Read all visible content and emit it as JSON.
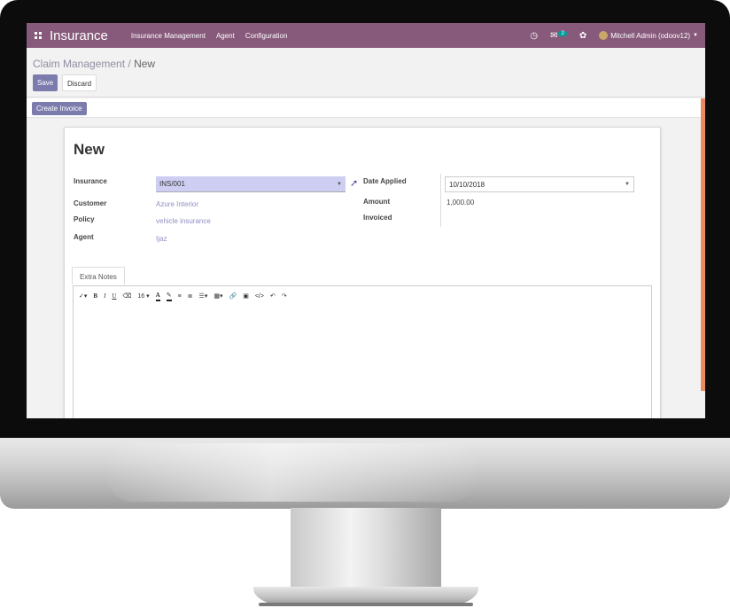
{
  "navbar": {
    "app_name": "Insurance",
    "menu": [
      "Insurance Management",
      "Agent",
      "Configuration"
    ],
    "chat_badge": "2",
    "user_name": "Mitchell Admin (odoov12)",
    "color": "#875a7b"
  },
  "control_panel": {
    "breadcrumb_parent": "Claim Management",
    "breadcrumb_sep": " / ",
    "breadcrumb_current": "New",
    "save_label": "Save",
    "discard_label": "Discard"
  },
  "statusbar": {
    "create_invoice_label": "Create Invoice"
  },
  "form": {
    "title": "New",
    "insurance_label": "Insurance",
    "insurance_value": "INS/001",
    "customer_label": "Customer",
    "customer_value": "Azure Interior",
    "policy_label": "Policy",
    "policy_value": "vehicle insurance",
    "agent_label": "Agent",
    "agent_value": "Ijaz",
    "date_applied_label": "Date Applied",
    "date_applied_value": "10/10/2018",
    "amount_label": "Amount",
    "amount_value": "1,000.00",
    "invoiced_label": "Invoiced"
  },
  "notebook": {
    "tab_label": "Extra Notes"
  },
  "editor_toolbar": {
    "font_size": "16",
    "bold": "B",
    "italic": "I",
    "underline": "U",
    "font_color": "A"
  }
}
